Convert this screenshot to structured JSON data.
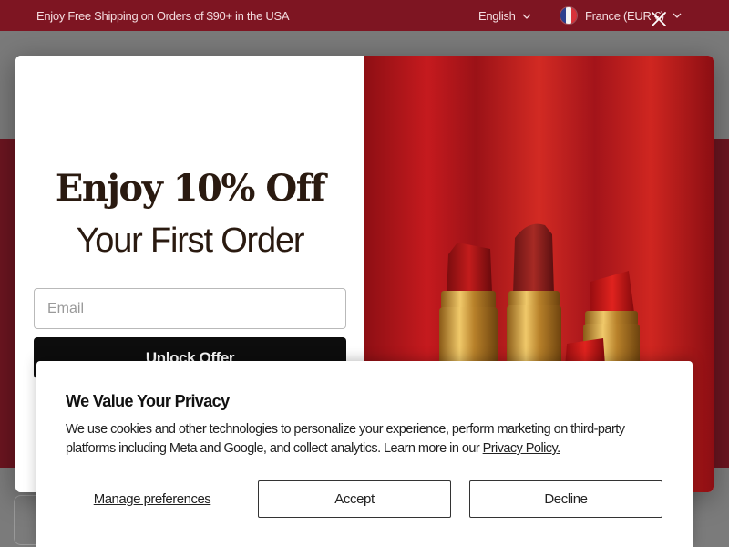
{
  "announcement": {
    "promo_text": "Enjoy Free Shipping on Orders of $90+ in the USA",
    "language": "English",
    "country": "France (EUR €)",
    "chevron_icon": "chevron-down-icon",
    "flag_icon": "france-flag-icon"
  },
  "popup": {
    "headline_line1": "Enjoy 10% Off",
    "headline_line2": "Your First Order",
    "email_placeholder": "Email",
    "submit_label": "Unlock Offer",
    "close_icon": "close-icon",
    "image_subject": "lipsticks-product-image"
  },
  "cookie_banner": {
    "title": "We Value Your Privacy",
    "body": "We use cookies and other technologies to personalize your experience, perform marketing on third-party platforms including Meta and Google, and collect analytics. Learn more in our",
    "policy_link": "Privacy Policy.",
    "manage_label": "Manage preferences",
    "accept_label": "Accept",
    "decline_label": "Decline"
  },
  "colors": {
    "brand_red": "#7e1522",
    "button_black": "#0d0d0d",
    "lipstick_red": "#c51a1e",
    "gold": "#d9a441"
  }
}
